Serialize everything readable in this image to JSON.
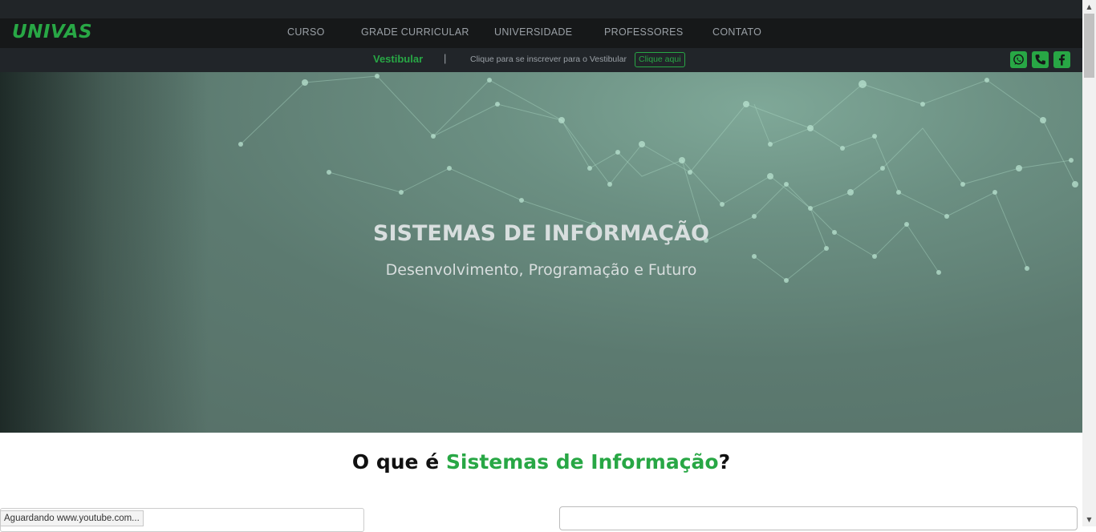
{
  "brand": {
    "logo": "UNIVAS",
    "accent_color": "#28a745"
  },
  "nav": {
    "items": [
      {
        "label": "CURSO"
      },
      {
        "label": "GRADE CURRICULAR"
      },
      {
        "label": "UNIVERSIDADE"
      },
      {
        "label": "PROFESSORES"
      },
      {
        "label": "CONTATO"
      }
    ]
  },
  "vestibular": {
    "label": "Vestibular",
    "separator": "|",
    "text": "Clique para se inscrever para o Vestibular",
    "button": "Clique aqui"
  },
  "social": [
    {
      "icon": "whatsapp-icon"
    },
    {
      "icon": "phone-icon"
    },
    {
      "icon": "facebook-icon"
    }
  ],
  "hero": {
    "title": "SISTEMAS DE INFORMAÇÃO",
    "subtitle": "Desenvolvimento, Programação e Futuro"
  },
  "section": {
    "title_prefix": "O que é ",
    "title_accent": "Sistemas de Informação",
    "title_suffix": "?"
  },
  "status": {
    "text": "Aguardando www.youtube.com..."
  },
  "scrollbar": {
    "up": "▲",
    "down": "▼"
  }
}
